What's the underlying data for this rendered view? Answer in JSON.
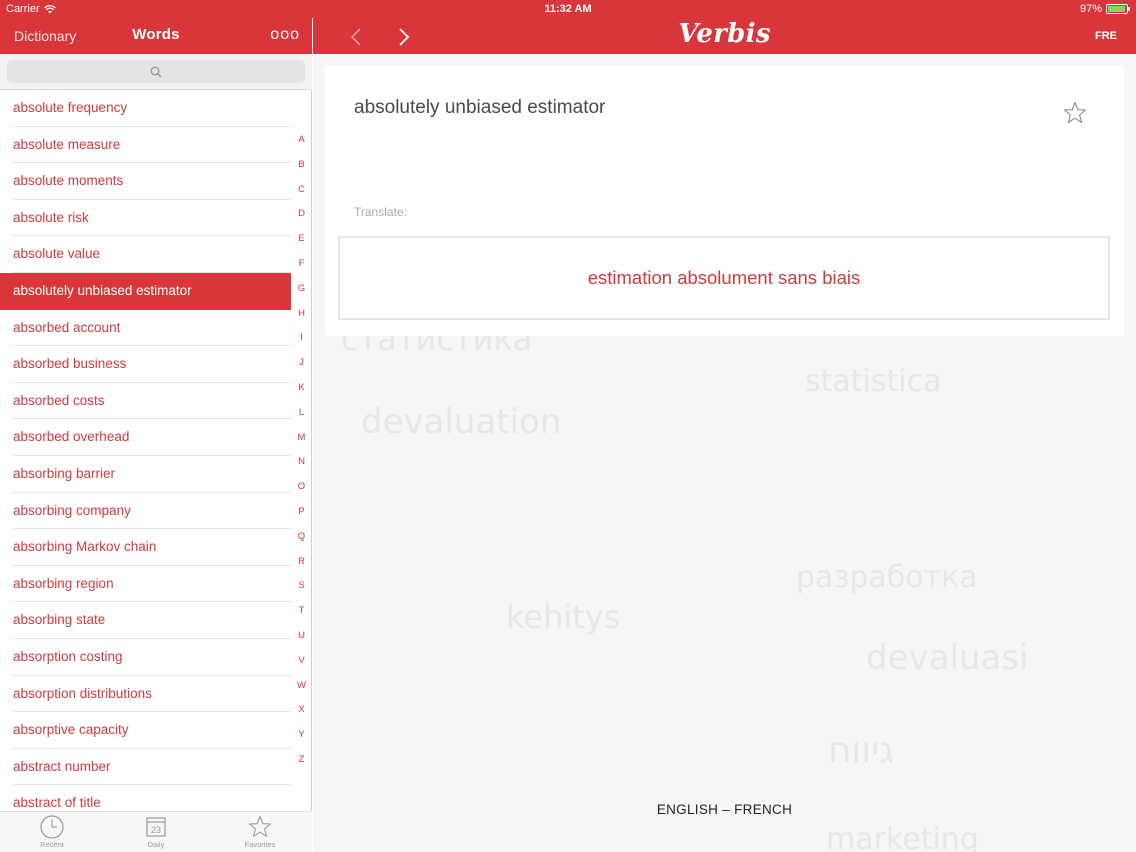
{
  "status": {
    "carrier": "Carrier",
    "time": "11:32 AM",
    "battery": "97%",
    "battery_level": 0.97
  },
  "left_header": {
    "dictionary_label": "Dictionary",
    "title": "Words",
    "more_label": "ooo"
  },
  "search": {
    "placeholder": ""
  },
  "words": [
    "absolute frequency",
    "absolute measure",
    "absolute moments",
    "absolute risk",
    "absolute value",
    "absolutely unbiased estimator",
    "absorbed account",
    "absorbed business",
    "absorbed costs",
    "absorbed overhead",
    "absorbing barrier",
    "absorbing company",
    "absorbing Markov chain",
    "absorbing region",
    "absorbing state",
    "absorption costing",
    "absorption distributions",
    "absorptive capacity",
    "abstract number",
    "abstract of title"
  ],
  "selected_index": 5,
  "alphabet": [
    "A",
    "B",
    "C",
    "D",
    "E",
    "F",
    "G",
    "H",
    "I",
    "J",
    "K",
    "L",
    "M",
    "N",
    "O",
    "P",
    "Q",
    "R",
    "S",
    "T",
    "U",
    "V",
    "W",
    "X",
    "Y",
    "Z"
  ],
  "tabs": {
    "recent": "Recent",
    "daily": "Daily",
    "daily_day": "23",
    "favorites": "Favorites"
  },
  "right_header": {
    "brand": "Verbis",
    "lang_code": "FRE"
  },
  "entry": {
    "term": "absolutely unbiased estimator",
    "translate_label": "Translate:",
    "translation": "estimation absolument sans biais"
  },
  "language_pair": "ENGLISH – FRENCH",
  "background_words": [
    "статистика",
    "statistica",
    "devaluation",
    "разработка",
    "kehitys",
    "devaluasi",
    "גיווח",
    "marketing"
  ],
  "colors": {
    "accent": "#d9363c",
    "word_text": "#cf3a3f",
    "selected_text": "#ffffff",
    "panel_bg": "#f6f6f6"
  }
}
